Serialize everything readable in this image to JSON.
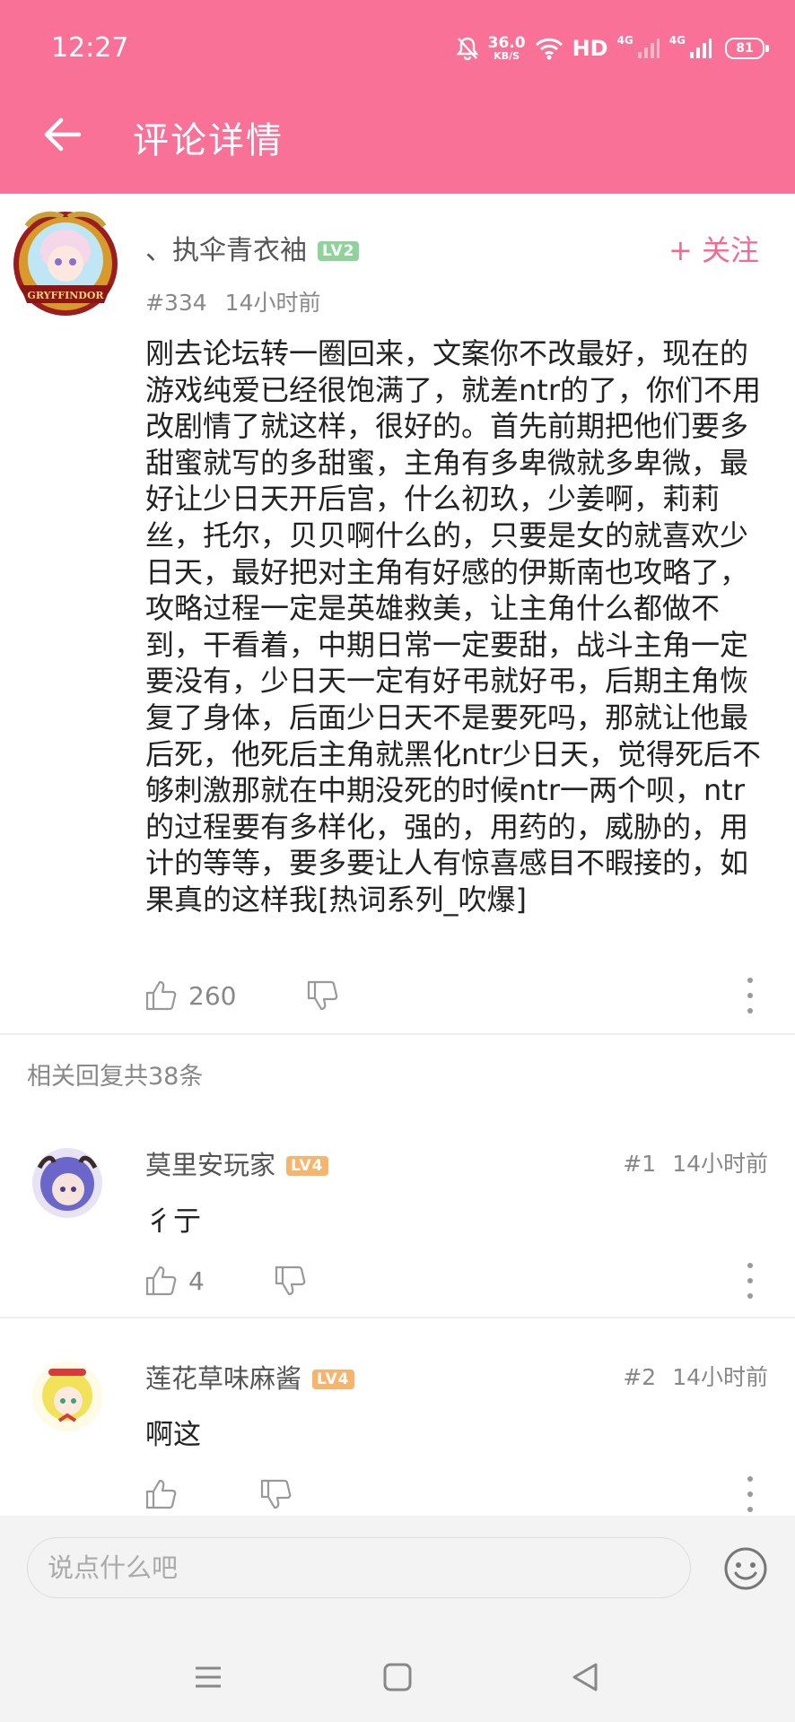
{
  "status_bar": {
    "time": "12:27",
    "net_speed_value": "36.0",
    "net_speed_unit": "KB/S",
    "hd": "HD",
    "sim1_label": "4G",
    "sim2_label": "4G",
    "battery": "81"
  },
  "header": {
    "title": "评论详情"
  },
  "main_comment": {
    "username": "、执伞青衣袖",
    "level": "LV2",
    "follow_label": "+ 关注",
    "floor": "#334",
    "time": "14小时前",
    "text": "刚去论坛转一圈回来，文案你不改最好，现在的游戏纯爱已经很饱满了，就差ntr的了，你们不用改剧情了就这样，很好的。首先前期把他们要多甜蜜就写的多甜蜜，主角有多卑微就多卑微，最好让少日天开后宫，什么初玖，少姜啊，莉莉丝，托尔，贝贝啊什么的，只要是女的就喜欢少日天，最好把对主角有好感的伊斯南也攻略了，攻略过程一定是英雄救美，让主角什么都做不到，干看着，中期日常一定要甜，战斗主角一定要没有，少日天一定有好弔就好弔，后期主角恢复了身体，后面少日天不是要死吗，那就让他最后死，他死后主角就黑化ntr少日天，觉得死后不够刺激那就在中期没死的时候ntr一两个呗，ntr的过程要有多样化，强的，用药的，威胁的，用计的等等，要多要让人有惊喜感目不暇接的，如果真的这样我[热词系列_吹爆]",
    "likes": "260",
    "avatar_caption": "GRYFFINDOR"
  },
  "replies_header": "相关回复共38条",
  "replies": [
    {
      "username": "莫里安玩家",
      "level": "LV4",
      "floor": "#1",
      "time": "14小时前",
      "text": "彳亍",
      "likes": "4"
    },
    {
      "username": "莲花草味麻酱",
      "level": "LV4",
      "floor": "#2",
      "time": "14小时前",
      "text": "啊这",
      "likes": ""
    }
  ],
  "input": {
    "placeholder": "说点什么吧"
  },
  "colors": {
    "header_bg": "#fa7198",
    "follow": "#f4698f",
    "level_green": "#8fd39a",
    "level_orange": "#f7b46d"
  }
}
